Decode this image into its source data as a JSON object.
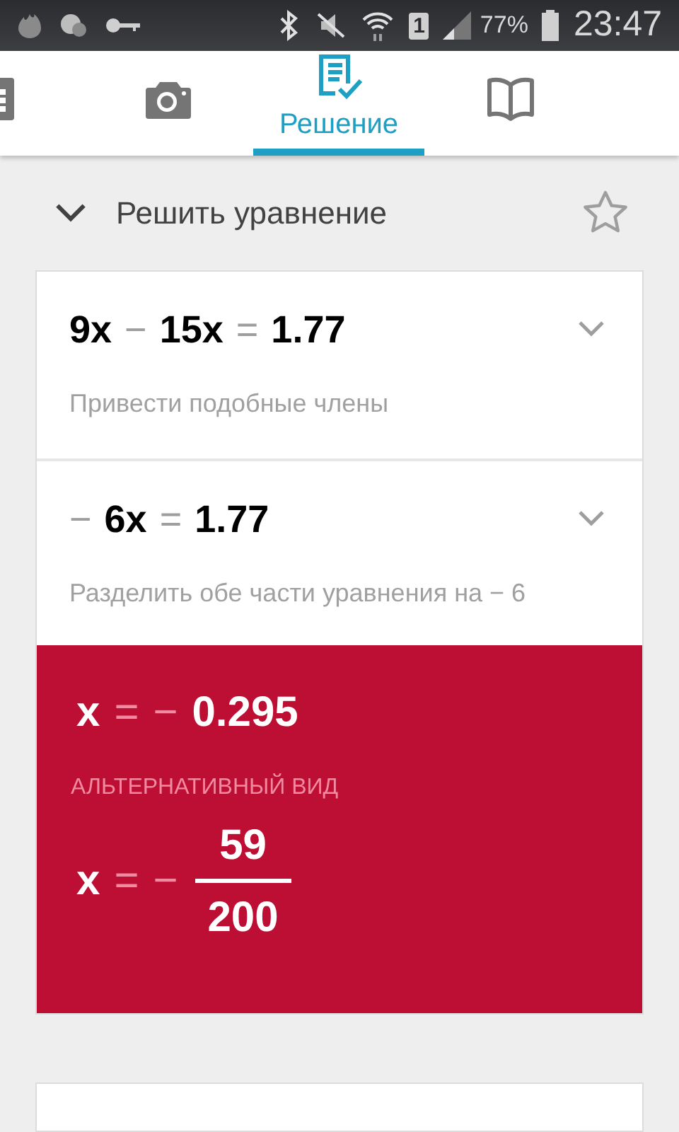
{
  "status_bar": {
    "sim": "1",
    "battery": "77%",
    "time": "23:47"
  },
  "tabs": [
    {
      "kind": "calculator",
      "selected": false
    },
    {
      "kind": "camera",
      "selected": false
    },
    {
      "kind": "solution",
      "label": "Решение",
      "selected": true
    },
    {
      "kind": "book",
      "selected": false
    }
  ],
  "header": {
    "title": "Решить уравнение",
    "expanded": true,
    "starred": false
  },
  "steps": [
    {
      "tokens": [
        {
          "kind": "term",
          "text": "9x"
        },
        {
          "kind": "op",
          "text": "−"
        },
        {
          "kind": "term",
          "text": "15x"
        },
        {
          "kind": "op",
          "text": "="
        },
        {
          "kind": "term",
          "text": "1.77"
        }
      ],
      "hint": "Привести подобные члены",
      "expanded": false
    },
    {
      "tokens": [
        {
          "kind": "op",
          "text": "−"
        },
        {
          "kind": "term",
          "text": "6x"
        },
        {
          "kind": "op",
          "text": "="
        },
        {
          "kind": "term",
          "text": "1.77"
        }
      ],
      "hint": "Разделить обе части уравнения на − 6",
      "expanded": false
    }
  ],
  "result": {
    "tokens": [
      {
        "kind": "term",
        "text": "x"
      },
      {
        "kind": "op",
        "text": "="
      },
      {
        "kind": "op",
        "text": "−"
      },
      {
        "kind": "term",
        "text": "0.295"
      }
    ],
    "alt_label": "АЛЬТЕРНАТИВНЫЙ ВИД",
    "alt_tokens": [
      {
        "kind": "term",
        "text": "x"
      },
      {
        "kind": "op",
        "text": "="
      },
      {
        "kind": "op",
        "text": "−"
      }
    ],
    "numerator": "59",
    "denominator": "200"
  }
}
